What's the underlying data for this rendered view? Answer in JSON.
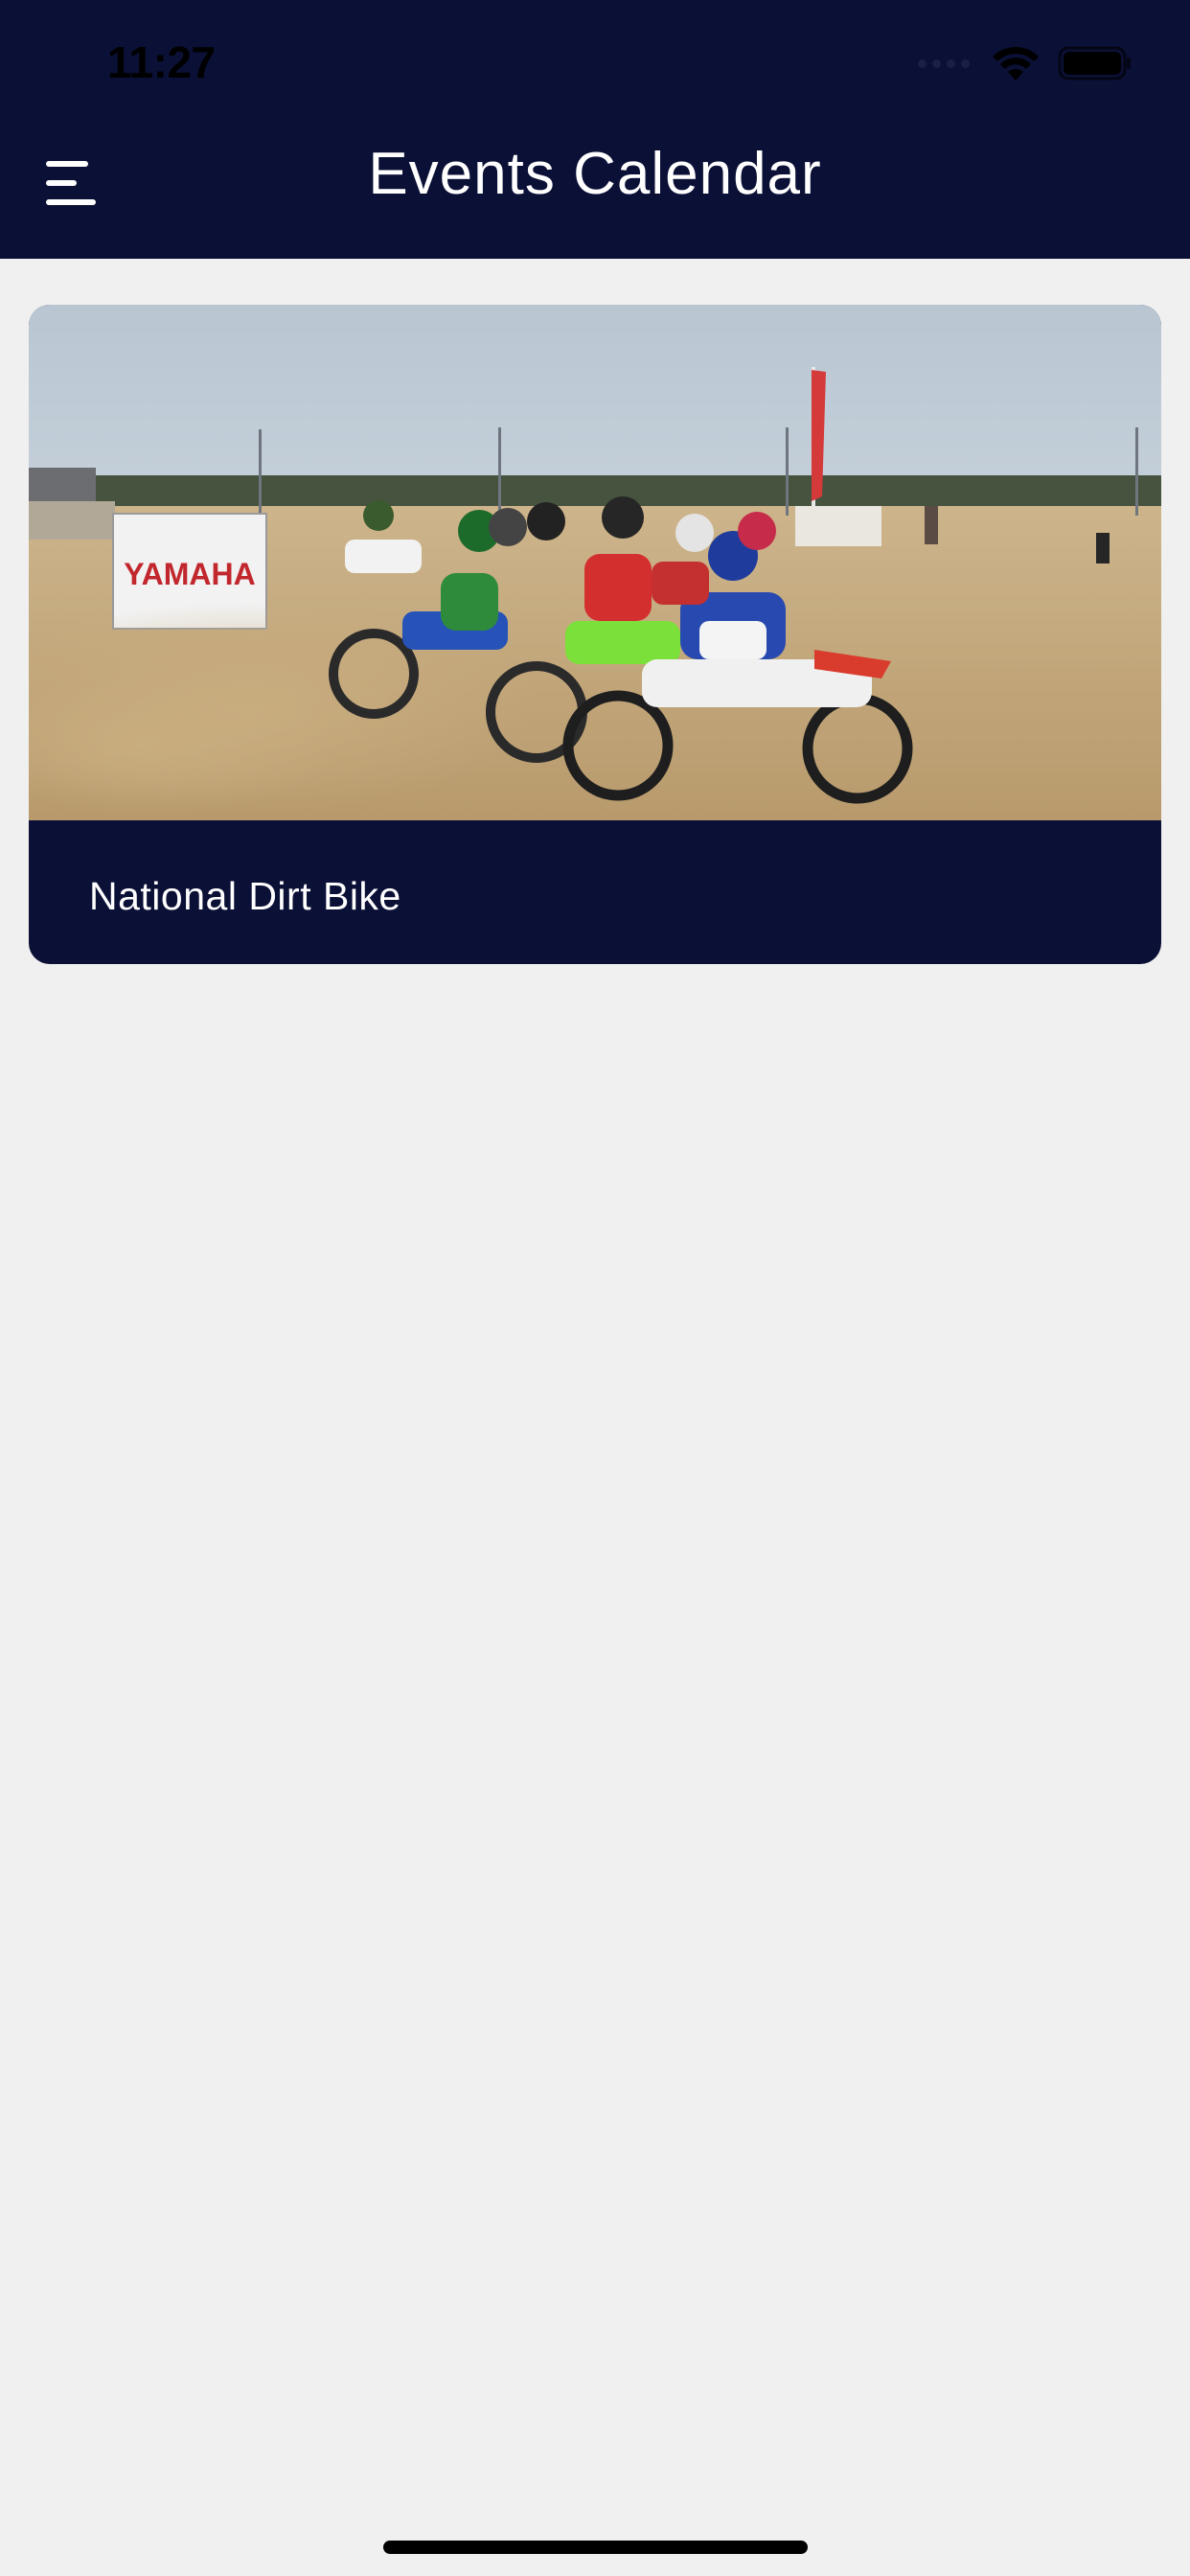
{
  "status_bar": {
    "time": "11:27"
  },
  "nav": {
    "title": "Events Calendar",
    "menu_icon": "hamburger-menu-icon"
  },
  "events": [
    {
      "title": "National Dirt Bike",
      "image": "dirt-bike-race-photo",
      "banner_text": "YAMAHA"
    }
  ],
  "colors": {
    "header_bg": "#0b1036",
    "page_bg": "#f0f0f0",
    "card_bg": "#0b1036",
    "text_light": "#ffffff"
  }
}
